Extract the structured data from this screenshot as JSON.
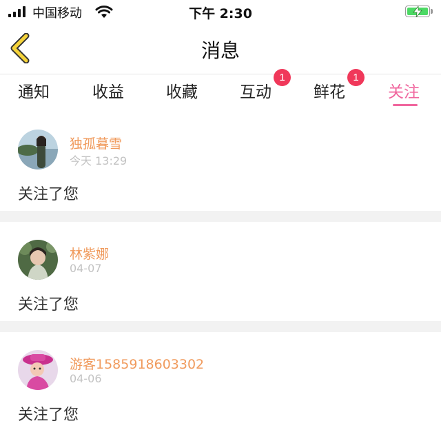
{
  "status_bar": {
    "carrier": "中国移动",
    "time": "下午 2:30",
    "battery_state": "charging",
    "battery_color": "#4cd964"
  },
  "nav": {
    "back_icon": "chevron-left-icon",
    "back_color": "#f5d33a",
    "title": "消息"
  },
  "tabs": [
    {
      "label": "通知",
      "badge": ""
    },
    {
      "label": "收益",
      "badge": ""
    },
    {
      "label": "收藏",
      "badge": ""
    },
    {
      "label": "互动",
      "badge": "1"
    },
    {
      "label": "鲜花",
      "badge": "1"
    },
    {
      "label": "关注",
      "badge": "",
      "active": true
    }
  ],
  "colors": {
    "accent": "#f0669e",
    "username": "#f09a5c",
    "badge": "#f0385a"
  },
  "items": [
    {
      "name": "独孤暮雪",
      "time": "今天 13:29",
      "message": "关注了您"
    },
    {
      "name": "林紫娜",
      "time": "04-07",
      "message": "关注了您"
    },
    {
      "name": "游客1585918603302",
      "time": "04-06",
      "message": "关注了您"
    }
  ]
}
